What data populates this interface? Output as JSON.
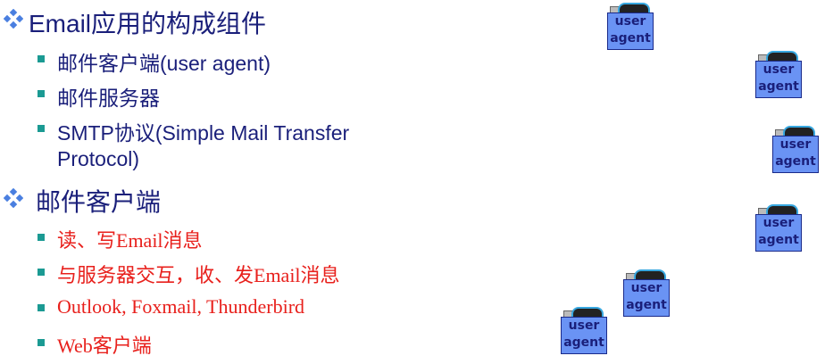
{
  "sections": [
    {
      "title": "Email应用的构成组件",
      "items": [
        "邮件客户端(user agent)",
        "邮件服务器",
        "SMTP协议(Simple Mail Transfer",
        "Protocol)"
      ]
    },
    {
      "title": "邮件客户端",
      "items": [
        "读、写Email消息",
        "与服务器交互，收、发Email消息",
        "Outlook, Foxmail, Thunderbird",
        "Web客户端"
      ]
    }
  ],
  "agent": {
    "line1": "user",
    "line2": "agent"
  },
  "colors": {
    "heading": "#1a1f7a",
    "red": "#e8201c",
    "bullet": "#1b9a93",
    "agent_box": "#6a93f4"
  }
}
